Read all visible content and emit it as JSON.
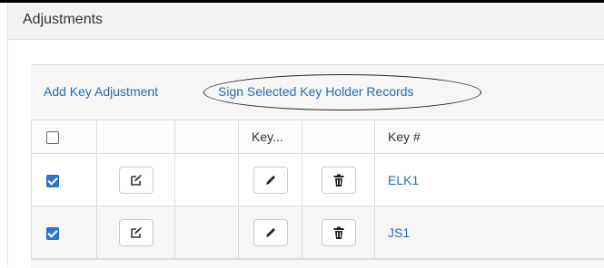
{
  "header": {
    "title": "Adjustments"
  },
  "toolbar": {
    "add_label": "Add Key Adjustment",
    "sign_label": "Sign Selected Key Holder Records"
  },
  "table": {
    "columns": [
      "",
      "",
      "",
      "Key...",
      "",
      "Key #"
    ],
    "select_all_checked": false,
    "rows": [
      {
        "checked": true,
        "key_number": "ELK1"
      },
      {
        "checked": true,
        "key_number": "JS1"
      }
    ]
  },
  "icons": {
    "edit_record": "edit-square-icon",
    "edit_key": "pencil-icon",
    "delete": "trash-icon"
  },
  "colors": {
    "link": "#2a6ab3",
    "checkbox": "#2f77cf",
    "header_bg": "#f3f3f3"
  }
}
